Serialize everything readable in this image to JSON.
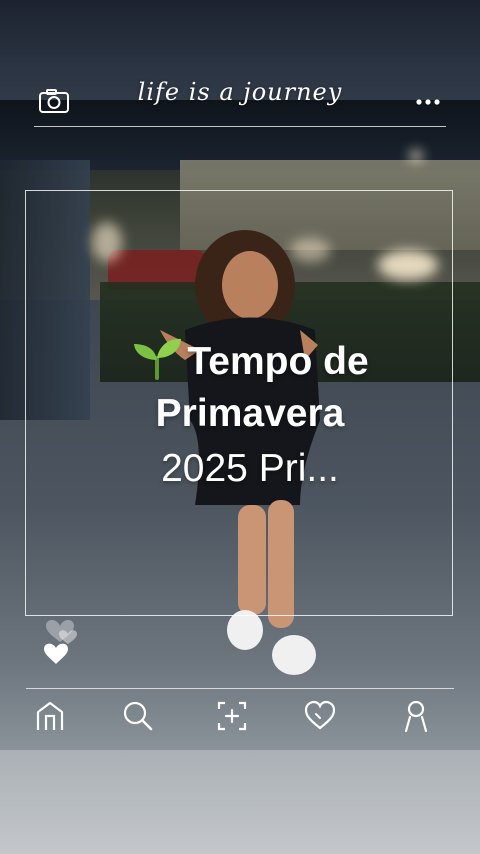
{
  "header": {
    "tagline": "life is a journey",
    "camera_icon": "camera-icon",
    "more_icon": "more-dots-icon"
  },
  "overlay": {
    "title_emoji": "seedling-icon",
    "title_line1": "Tempo de",
    "title_line2": "Primavera",
    "subtitle": "2025 Pri..."
  },
  "hearts_icon": "hearts-icon",
  "nav": {
    "items": [
      {
        "icon": "home-icon"
      },
      {
        "icon": "search-icon"
      },
      {
        "icon": "add-post-icon"
      },
      {
        "icon": "heart-icon"
      },
      {
        "icon": "profile-icon"
      }
    ]
  },
  "colors": {
    "overlay_text": "#ffffff",
    "sprout_green": "#7cc242"
  }
}
